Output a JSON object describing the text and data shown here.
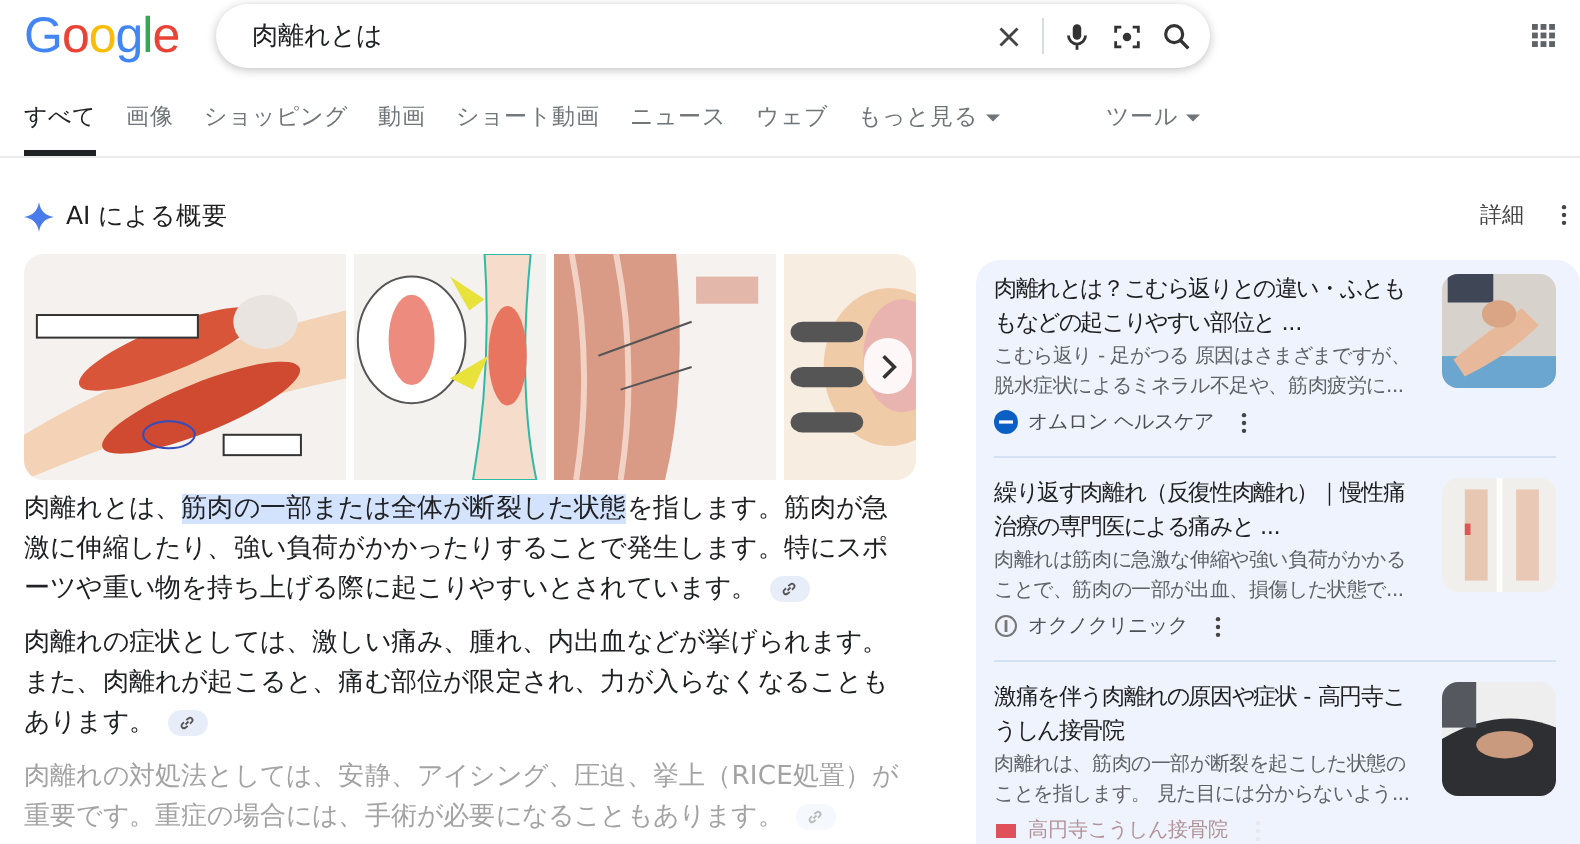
{
  "logo": "Google",
  "search": {
    "value": "肉離れとは"
  },
  "tabs": [
    {
      "label": "すべて",
      "selected": true,
      "has_caret": false
    },
    {
      "label": "画像",
      "selected": false,
      "has_caret": false
    },
    {
      "label": "ショッピング",
      "selected": false,
      "has_caret": false
    },
    {
      "label": "動画",
      "selected": false,
      "has_caret": false
    },
    {
      "label": "ショート動画",
      "selected": false,
      "has_caret": false
    },
    {
      "label": "ニュース",
      "selected": false,
      "has_caret": false
    },
    {
      "label": "ウェブ",
      "selected": false,
      "has_caret": false
    },
    {
      "label": "もっと見る",
      "selected": false,
      "has_caret": true
    }
  ],
  "tools": {
    "label": "ツール",
    "has_caret": true
  },
  "ai_overview": {
    "title": "AI による概要",
    "details_link": "詳細",
    "paragraphs": [
      {
        "faded": false,
        "segments": [
          {
            "text": "肉離れとは、",
            "highlighted": false
          },
          {
            "text": "筋肉の一部または全体が断裂した状態",
            "highlighted": true
          },
          {
            "text": "を指します。筋肉が急激に伸縮したり、強い負荷がかかったりすることで発生します。特にスポーツや重い物を持ち上げる際に起こりやすいとされています。",
            "highlighted": false
          }
        ]
      },
      {
        "faded": false,
        "segments": [
          {
            "text": "肉離れの症状としては、激しい痛み、腫れ、内出血などが挙げられます。また、肉離れが起こると、痛む部位が限定され、力が入らなくなることもあります。",
            "highlighted": false
          }
        ]
      },
      {
        "faded": true,
        "segments": [
          {
            "text": "肉離れの対処法としては、安静、アイシング、圧迫、挙上（RICE処置）が重要です。重症の場合には、手術が必要になることもあります。",
            "highlighted": false
          }
        ]
      }
    ]
  },
  "sources": [
    {
      "title": "肉離れとは？こむら返りとの違い・ふとももなどの起こりやすい部位と ...",
      "snippet": "こむら返り - 足がつる 原因はさまざまですが、脱水症状によるミネラル不足や、筋肉疲労に...",
      "source": "オムロン ヘルスケア",
      "favicon": {
        "kind": "disc",
        "color": "#0a5fc4"
      },
      "faded": false
    },
    {
      "title": "繰り返す肉離れ（反復性肉離れ）｜慢性痛治療の専門医による痛みと ...",
      "snippet": "肉離れは筋肉に急激な伸縮や強い負荷がかかることで、筋肉の一部が出血、損傷した状態で...",
      "source": "オクノクリニック",
      "favicon": {
        "kind": "ring",
        "color": "#777777"
      },
      "faded": false
    },
    {
      "title": "激痛を伴う肉離れの原因や症状 - 高円寺こうしん接骨院",
      "snippet": "肉離れは、筋肉の一部が断裂を起こした状態のことを指します。 見た目には分からないよう...",
      "source": "高円寺こうしん接骨院",
      "favicon": {
        "kind": "mark",
        "color": "#e0505a"
      },
      "faded": true
    }
  ]
}
